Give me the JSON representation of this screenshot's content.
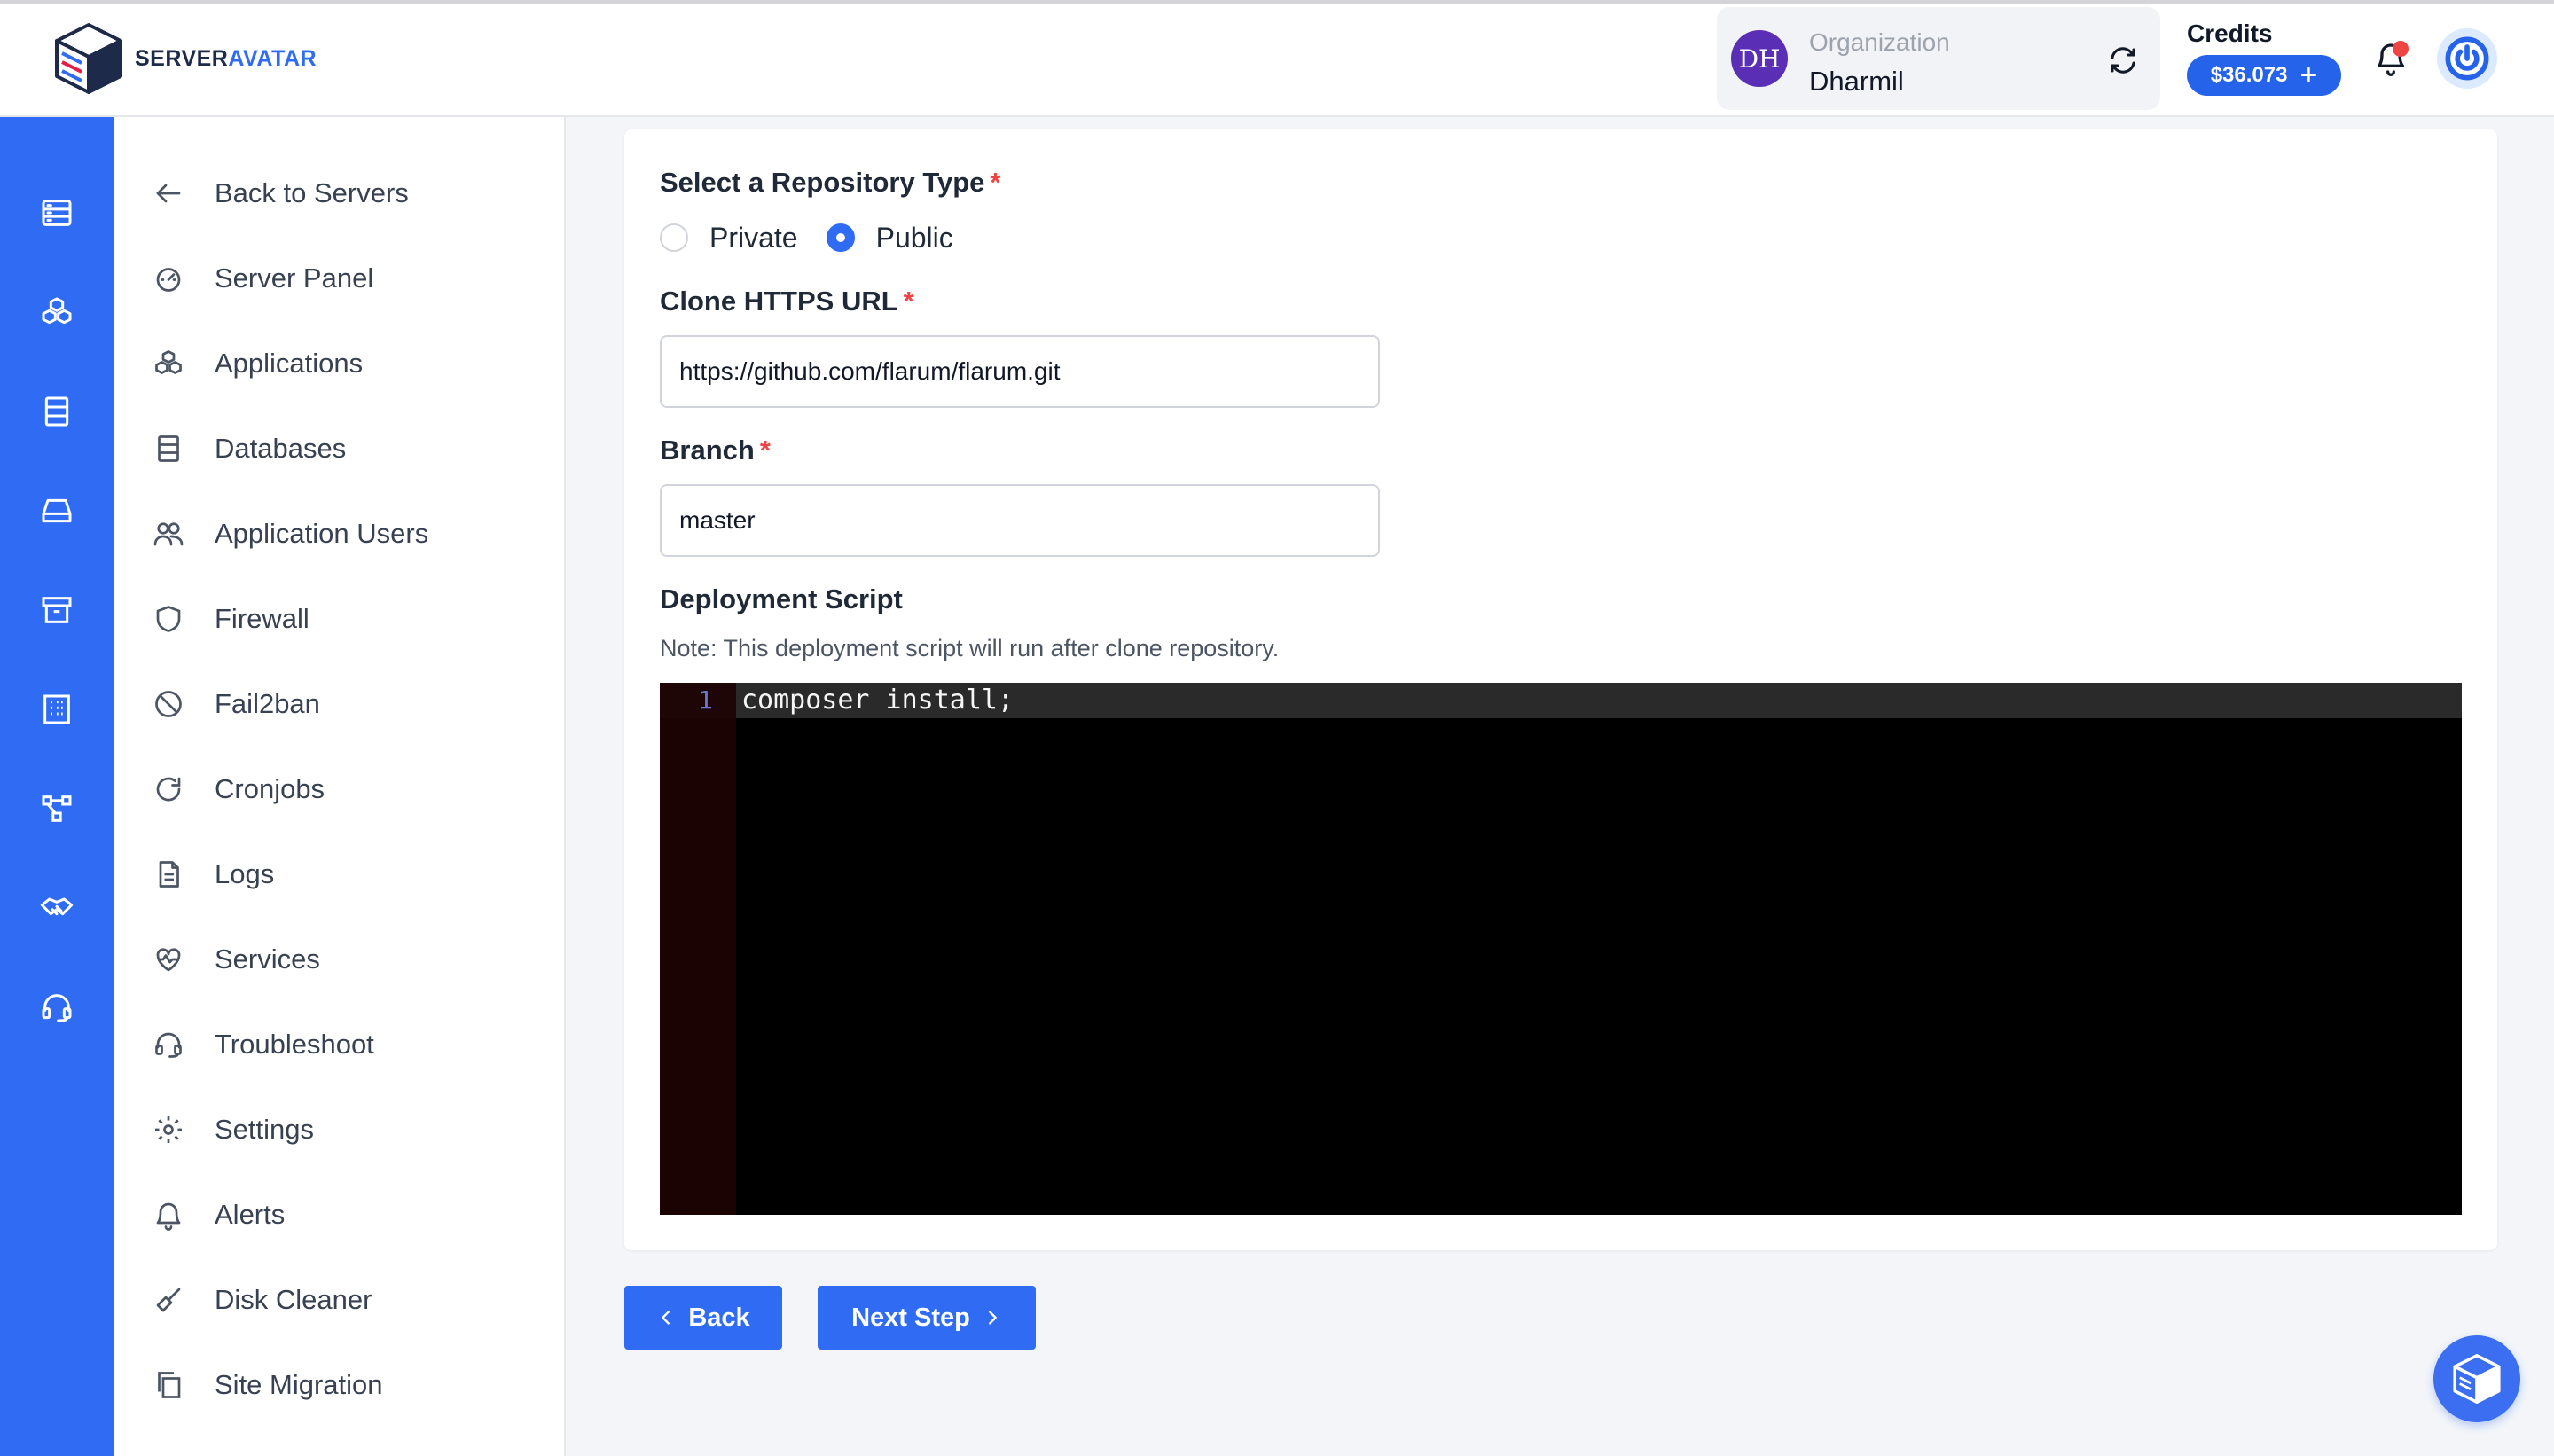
{
  "brand": {
    "name_part1": "SERVER",
    "name_part2": "AVATAR"
  },
  "header": {
    "org_initials": "DH",
    "org_label": "Organization",
    "org_name": "Dharmil",
    "credits_label": "Credits",
    "credits_value": "$36.073",
    "credits_add": "+"
  },
  "rail": {
    "icons": [
      "servers-icon",
      "applications-icon",
      "databases-icon",
      "storage-icon",
      "archive-icon",
      "organization-icon",
      "network-icon",
      "partners-icon",
      "support-icon"
    ]
  },
  "sidebar": {
    "items": [
      {
        "label": "Back to Servers",
        "icon": "arrow-left-icon"
      },
      {
        "label": "Server Panel",
        "icon": "gauge-icon"
      },
      {
        "label": "Applications",
        "icon": "cubes-icon"
      },
      {
        "label": "Databases",
        "icon": "database-icon"
      },
      {
        "label": "Application Users",
        "icon": "users-icon"
      },
      {
        "label": "Firewall",
        "icon": "shield-icon"
      },
      {
        "label": "Fail2ban",
        "icon": "ban-icon"
      },
      {
        "label": "Cronjobs",
        "icon": "refresh-icon"
      },
      {
        "label": "Logs",
        "icon": "document-icon"
      },
      {
        "label": "Services",
        "icon": "heartbeat-icon"
      },
      {
        "label": "Troubleshoot",
        "icon": "headset-icon"
      },
      {
        "label": "Settings",
        "icon": "gear-icon"
      },
      {
        "label": "Alerts",
        "icon": "bell-icon"
      },
      {
        "label": "Disk Cleaner",
        "icon": "broom-icon"
      },
      {
        "label": "Site Migration",
        "icon": "copy-icon"
      }
    ]
  },
  "form": {
    "repo_type_label": "Select a Repository Type",
    "required_mark": "*",
    "private_label": "Private",
    "public_label": "Public",
    "selected_type": "Public",
    "clone_label": "Clone HTTPS URL",
    "clone_value": "https://github.com/flarum/flarum.git",
    "branch_label": "Branch",
    "branch_value": "master",
    "script_label": "Deployment Script",
    "script_note": "Note: This deployment script will run after clone repository.",
    "script_line_number": "1",
    "script_code": "composer install;"
  },
  "actions": {
    "back_label": "Back",
    "next_label": "Next Step"
  },
  "colors": {
    "primary": "#2f6cf3",
    "required": "#ef4444",
    "editor_bg": "#000000"
  }
}
